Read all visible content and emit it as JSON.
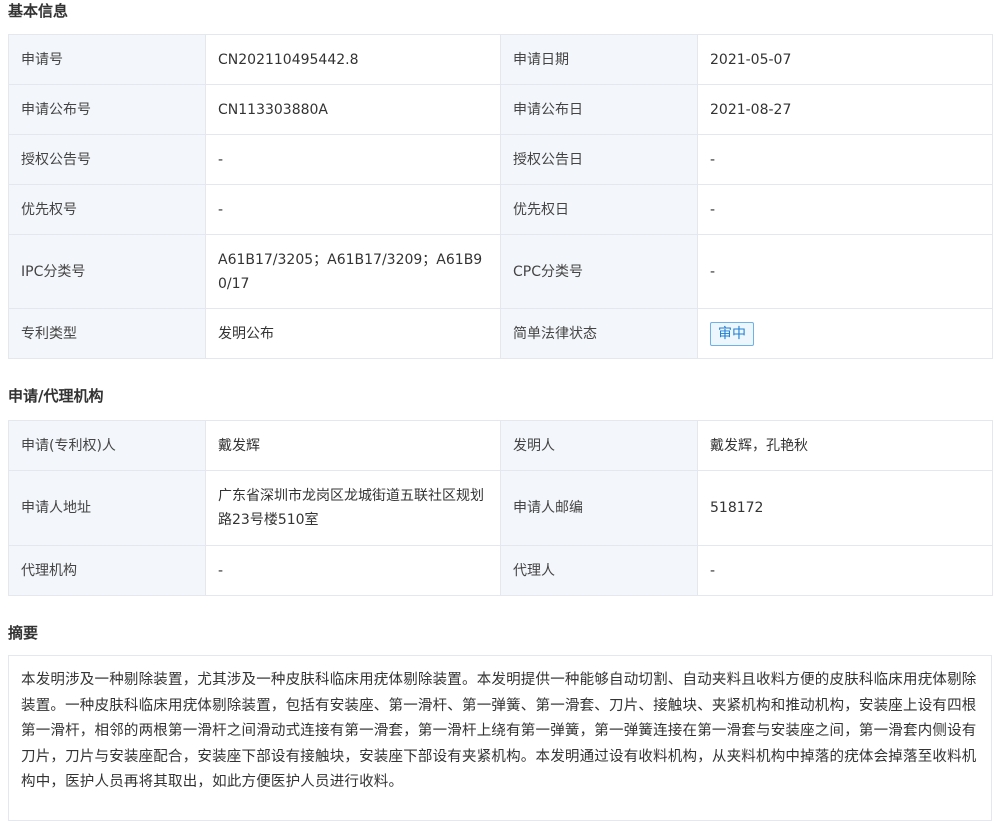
{
  "basic": {
    "title": "基本信息",
    "rows": [
      {
        "l1": "申请号",
        "v1": "CN202110495442.8",
        "l2": "申请日期",
        "v2": "2021-05-07"
      },
      {
        "l1": "申请公布号",
        "v1": "CN113303880A",
        "l2": "申请公布日",
        "v2": "2021-08-27"
      },
      {
        "l1": "授权公告号",
        "v1": "-",
        "l2": "授权公告日",
        "v2": "-"
      },
      {
        "l1": "优先权号",
        "v1": "-",
        "l2": "优先权日",
        "v2": "-"
      },
      {
        "l1": "IPC分类号",
        "v1": "A61B17/3205；A61B17/3209；A61B90/17",
        "l2": "CPC分类号",
        "v2": "-"
      },
      {
        "l1": "专利类型",
        "v1": "发明公布",
        "l2": "简单法律状态",
        "v2": "审中"
      }
    ]
  },
  "agency": {
    "title": "申请/代理机构",
    "rows": [
      {
        "l1": "申请(专利权)人",
        "v1": "戴发辉",
        "l2": "发明人",
        "v2": "戴发辉，孔艳秋"
      },
      {
        "l1": "申请人地址",
        "v1": "广东省深圳市龙岗区龙城街道五联社区规划路23号楼510室",
        "l2": "申请人邮编",
        "v2": "518172"
      },
      {
        "l1": "代理机构",
        "v1": "-",
        "l2": "代理人",
        "v2": "-"
      }
    ]
  },
  "abstract": {
    "title": "摘要",
    "text": "本发明涉及一种剔除装置，尤其涉及一种皮肤科临床用疣体剔除装置。本发明提供一种能够自动切割、自动夹料且收料方便的皮肤科临床用疣体剔除装置。一种皮肤科临床用疣体剔除装置，包括有安装座、第一滑杆、第一弹簧、第一滑套、刀片、接触块、夹紧机构和推动机构，安装座上设有四根第一滑杆，相邻的两根第一滑杆之间滑动式连接有第一滑套，第一滑杆上绕有第一弹簧，第一弹簧连接在第一滑套与安装座之间，第一滑套内侧设有刀片，刀片与安装座配合，安装座下部设有接触块，安装座下部设有夹紧机构。本发明通过设有收料机构，从夹料机构中掉落的疣体会掉落至收料机构中，医护人员再将其取出，如此方便医护人员进行收料。"
  }
}
